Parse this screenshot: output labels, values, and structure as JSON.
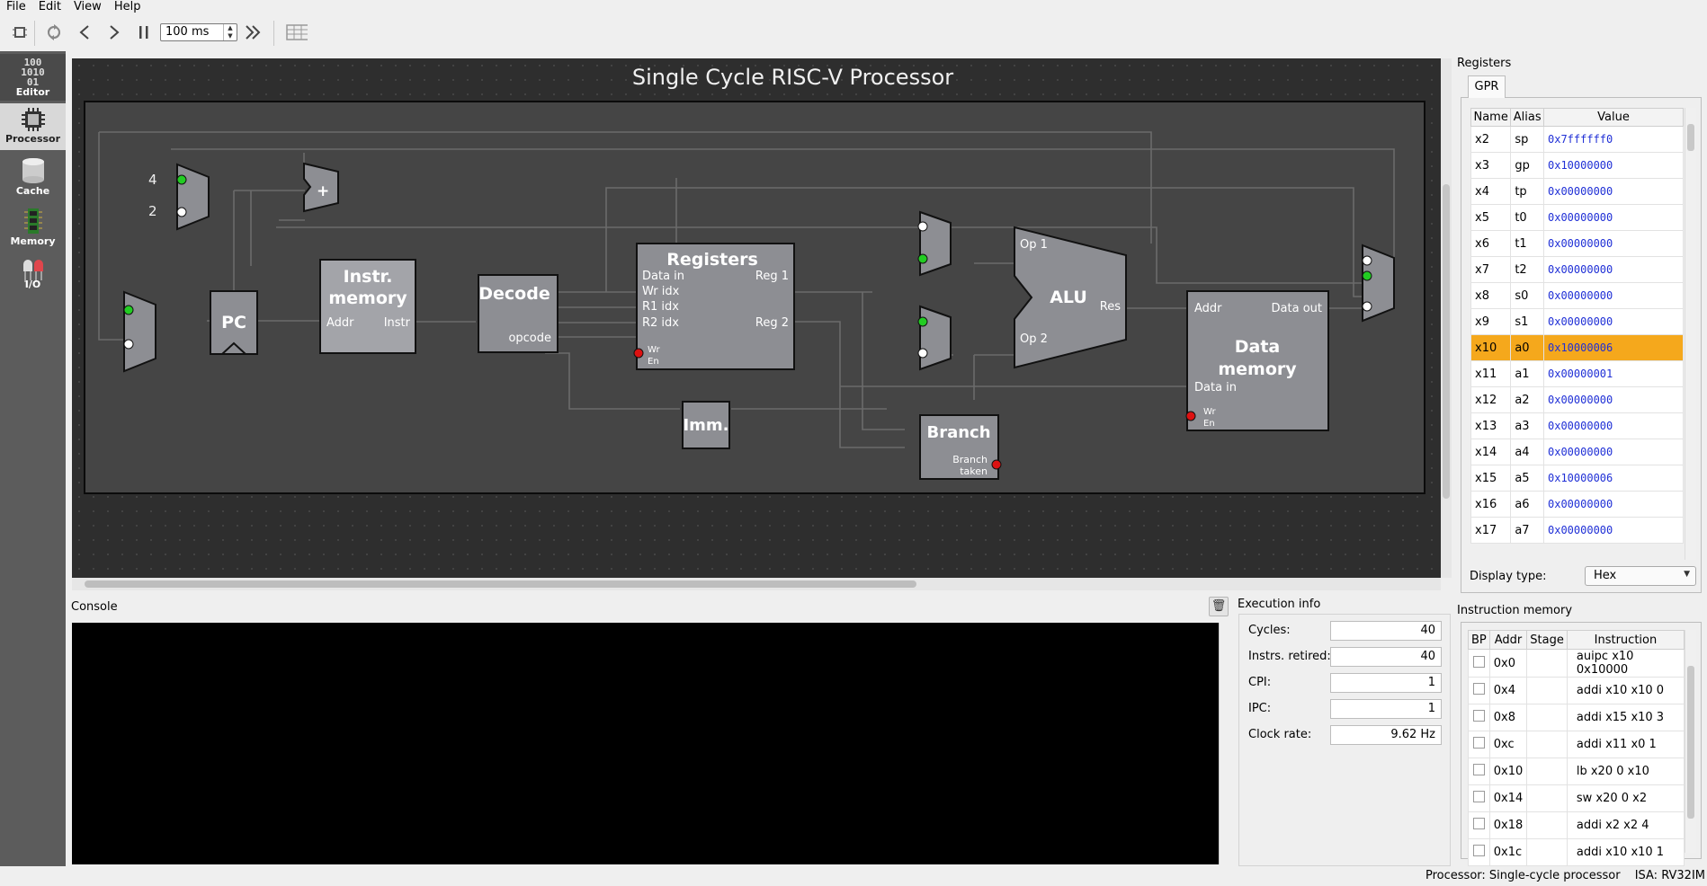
{
  "menu": [
    "File",
    "Edit",
    "View",
    "Help"
  ],
  "toolbar": {
    "speed_value": "100 ms",
    "buttons": [
      "chip-icon",
      "reset-icon",
      "step-back-icon",
      "step-forward-icon",
      "pause-icon",
      "run-icon",
      "table-icon"
    ]
  },
  "sidebar": {
    "items": [
      {
        "label": "Editor",
        "icon_text": "100 1010 01"
      },
      {
        "label": "Processor"
      },
      {
        "label": "Cache"
      },
      {
        "label": "Memory"
      },
      {
        "label": "I/O"
      }
    ]
  },
  "processor": {
    "title": "Single Cycle RISC-V Processor",
    "const_4": "4",
    "const_2": "2",
    "adder_symbol": "+",
    "pc": "PC",
    "imem": {
      "title": "Instr. memory",
      "addr": "Addr",
      "instr": "Instr"
    },
    "decode": {
      "title": "Decode",
      "opcode": "opcode"
    },
    "registers": {
      "title": "Registers",
      "data_in": "Data in",
      "wr_idx": "Wr idx",
      "r1_idx": "R1 idx",
      "r2_idx": "R2 idx",
      "reg1": "Reg 1",
      "reg2": "Reg 2",
      "wr_en": "Wr En"
    },
    "imm": "Imm.",
    "alu": {
      "title": "ALU",
      "op1": "Op 1",
      "op2": "Op 2",
      "res": "Res"
    },
    "branch": {
      "title": "Branch",
      "taken": "Branch taken"
    },
    "dmem": {
      "title": "Data memory",
      "addr": "Addr",
      "data_out": "Data out",
      "data_in": "Data in",
      "wr_en": "Wr En"
    }
  },
  "registers_panel": {
    "title": "Registers",
    "tab": "GPR",
    "columns": [
      "Name",
      "Alias",
      "Value"
    ],
    "rows": [
      {
        "name": "x2",
        "alias": "sp",
        "value": "0x7ffffff0"
      },
      {
        "name": "x3",
        "alias": "gp",
        "value": "0x10000000"
      },
      {
        "name": "x4",
        "alias": "tp",
        "value": "0x00000000"
      },
      {
        "name": "x5",
        "alias": "t0",
        "value": "0x00000000"
      },
      {
        "name": "x6",
        "alias": "t1",
        "value": "0x00000000"
      },
      {
        "name": "x7",
        "alias": "t2",
        "value": "0x00000000"
      },
      {
        "name": "x8",
        "alias": "s0",
        "value": "0x00000000"
      },
      {
        "name": "x9",
        "alias": "s1",
        "value": "0x00000000"
      },
      {
        "name": "x10",
        "alias": "a0",
        "value": "0x10000006"
      },
      {
        "name": "x11",
        "alias": "a1",
        "value": "0x00000001"
      },
      {
        "name": "x12",
        "alias": "a2",
        "value": "0x00000000"
      },
      {
        "name": "x13",
        "alias": "a3",
        "value": "0x00000000"
      },
      {
        "name": "x14",
        "alias": "a4",
        "value": "0x00000000"
      },
      {
        "name": "x15",
        "alias": "a5",
        "value": "0x10000006"
      },
      {
        "name": "x16",
        "alias": "a6",
        "value": "0x00000000"
      },
      {
        "name": "x17",
        "alias": "a7",
        "value": "0x00000000"
      }
    ],
    "highlight_color": "#f5a81c",
    "display_type_label": "Display type:",
    "display_type_value": "Hex"
  },
  "console": {
    "label": "Console"
  },
  "exec_info": {
    "title": "Execution info",
    "rows": [
      {
        "label": "Cycles:",
        "value": "40"
      },
      {
        "label": "Instrs. retired:",
        "value": "40"
      },
      {
        "label": "CPI:",
        "value": "1"
      },
      {
        "label": "IPC:",
        "value": "1"
      },
      {
        "label": "Clock rate:",
        "value": "9.62 Hz"
      }
    ]
  },
  "instruction_memory": {
    "title": "Instruction memory",
    "columns": [
      "BP",
      "Addr",
      "Stage",
      "Instruction"
    ],
    "rows": [
      {
        "addr": "0x0",
        "stage": "",
        "instr": "auipc x10 0x10000"
      },
      {
        "addr": "0x4",
        "stage": "",
        "instr": "addi x10 x10 0"
      },
      {
        "addr": "0x8",
        "stage": "",
        "instr": "addi x15 x10 3"
      },
      {
        "addr": "0xc",
        "stage": "",
        "instr": "addi x11 x0 1"
      },
      {
        "addr": "0x10",
        "stage": "",
        "instr": "lb x20 0 x10"
      },
      {
        "addr": "0x14",
        "stage": "",
        "instr": "sw x20 0 x2"
      },
      {
        "addr": "0x18",
        "stage": "",
        "instr": "addi x2 x2 4"
      },
      {
        "addr": "0x1c",
        "stage": "",
        "instr": "addi x10 x10 1"
      }
    ]
  },
  "status": {
    "processor": "Processor: Single-cycle processor",
    "isa": "ISA: RV32IM"
  },
  "colors": {
    "canvas": "#2e2e2e",
    "component": "#8d8e93",
    "port_active": "#22cc22",
    "port_inactive": "#ffffff",
    "port_red": "#dd1111"
  }
}
